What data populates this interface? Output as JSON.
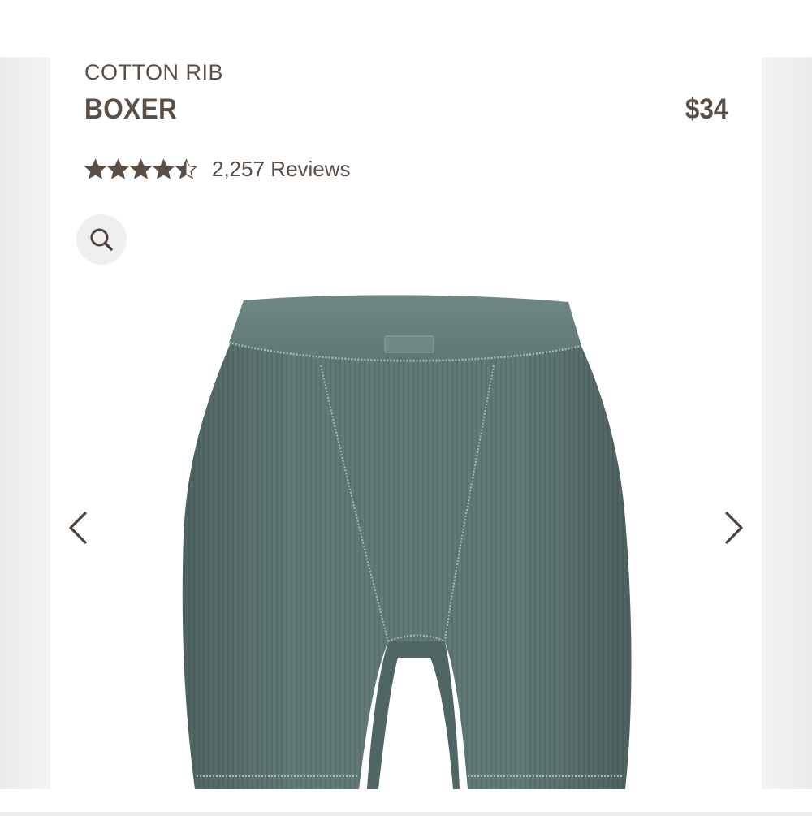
{
  "product": {
    "collection": "COTTON RIB",
    "name": "BOXER",
    "price": "$34"
  },
  "rating": {
    "value": 4.5,
    "max": 5,
    "reviews_text": "2,257 Reviews"
  },
  "icons": {
    "zoom": "search-icon",
    "prev": "chevron-left-icon",
    "next": "chevron-right-icon",
    "star": "star-icon"
  },
  "colors": {
    "text": "#5a4e46",
    "product": "#617a78"
  }
}
